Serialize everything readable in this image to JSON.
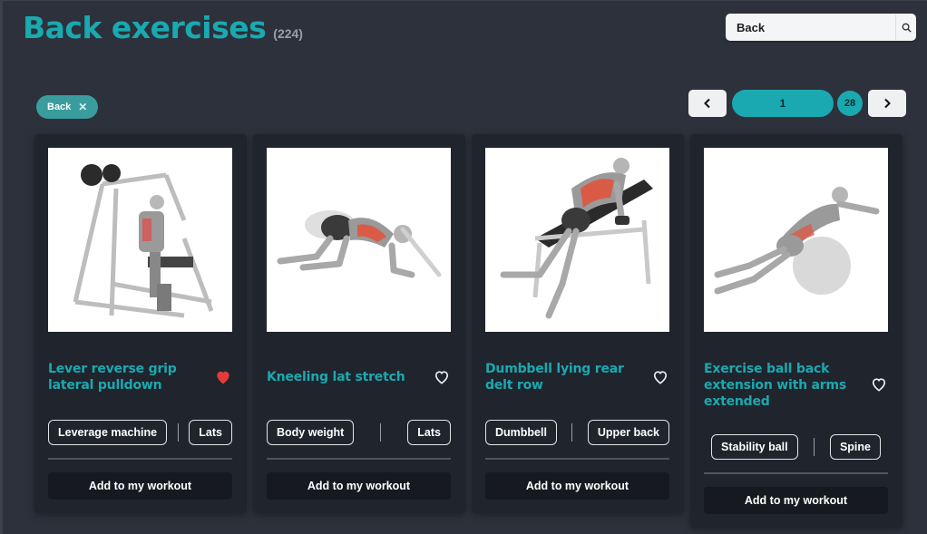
{
  "header": {
    "title": "Back exercises",
    "count": "(224)"
  },
  "search": {
    "value": "Back",
    "icon": "search-icon"
  },
  "filter_chip": {
    "label": "Back",
    "remove_symbol": "✕"
  },
  "pagination": {
    "current_page": "1",
    "total_pages": "28"
  },
  "colors": {
    "accent": "#1aa9b0",
    "favorite_active": "#e23b3b",
    "background": "#2d313b",
    "card": "#20242d"
  },
  "cards": [
    {
      "name": "Lever reverse grip lateral pulldown",
      "favorited": true,
      "tags": [
        "Leverage machine",
        "Lats"
      ],
      "button": "Add to my workout"
    },
    {
      "name": "Kneeling lat stretch",
      "favorited": false,
      "tags": [
        "Body weight",
        "Lats"
      ],
      "button": "Add to my workout"
    },
    {
      "name": "Dumbbell lying rear delt row",
      "favorited": false,
      "tags": [
        "Dumbbell",
        "Upper back"
      ],
      "button": "Add to my workout"
    },
    {
      "name": "Exercise ball back extension with arms extended",
      "favorited": false,
      "tags": [
        "Stability ball",
        "Spine"
      ],
      "button": "Add to my workout"
    }
  ]
}
